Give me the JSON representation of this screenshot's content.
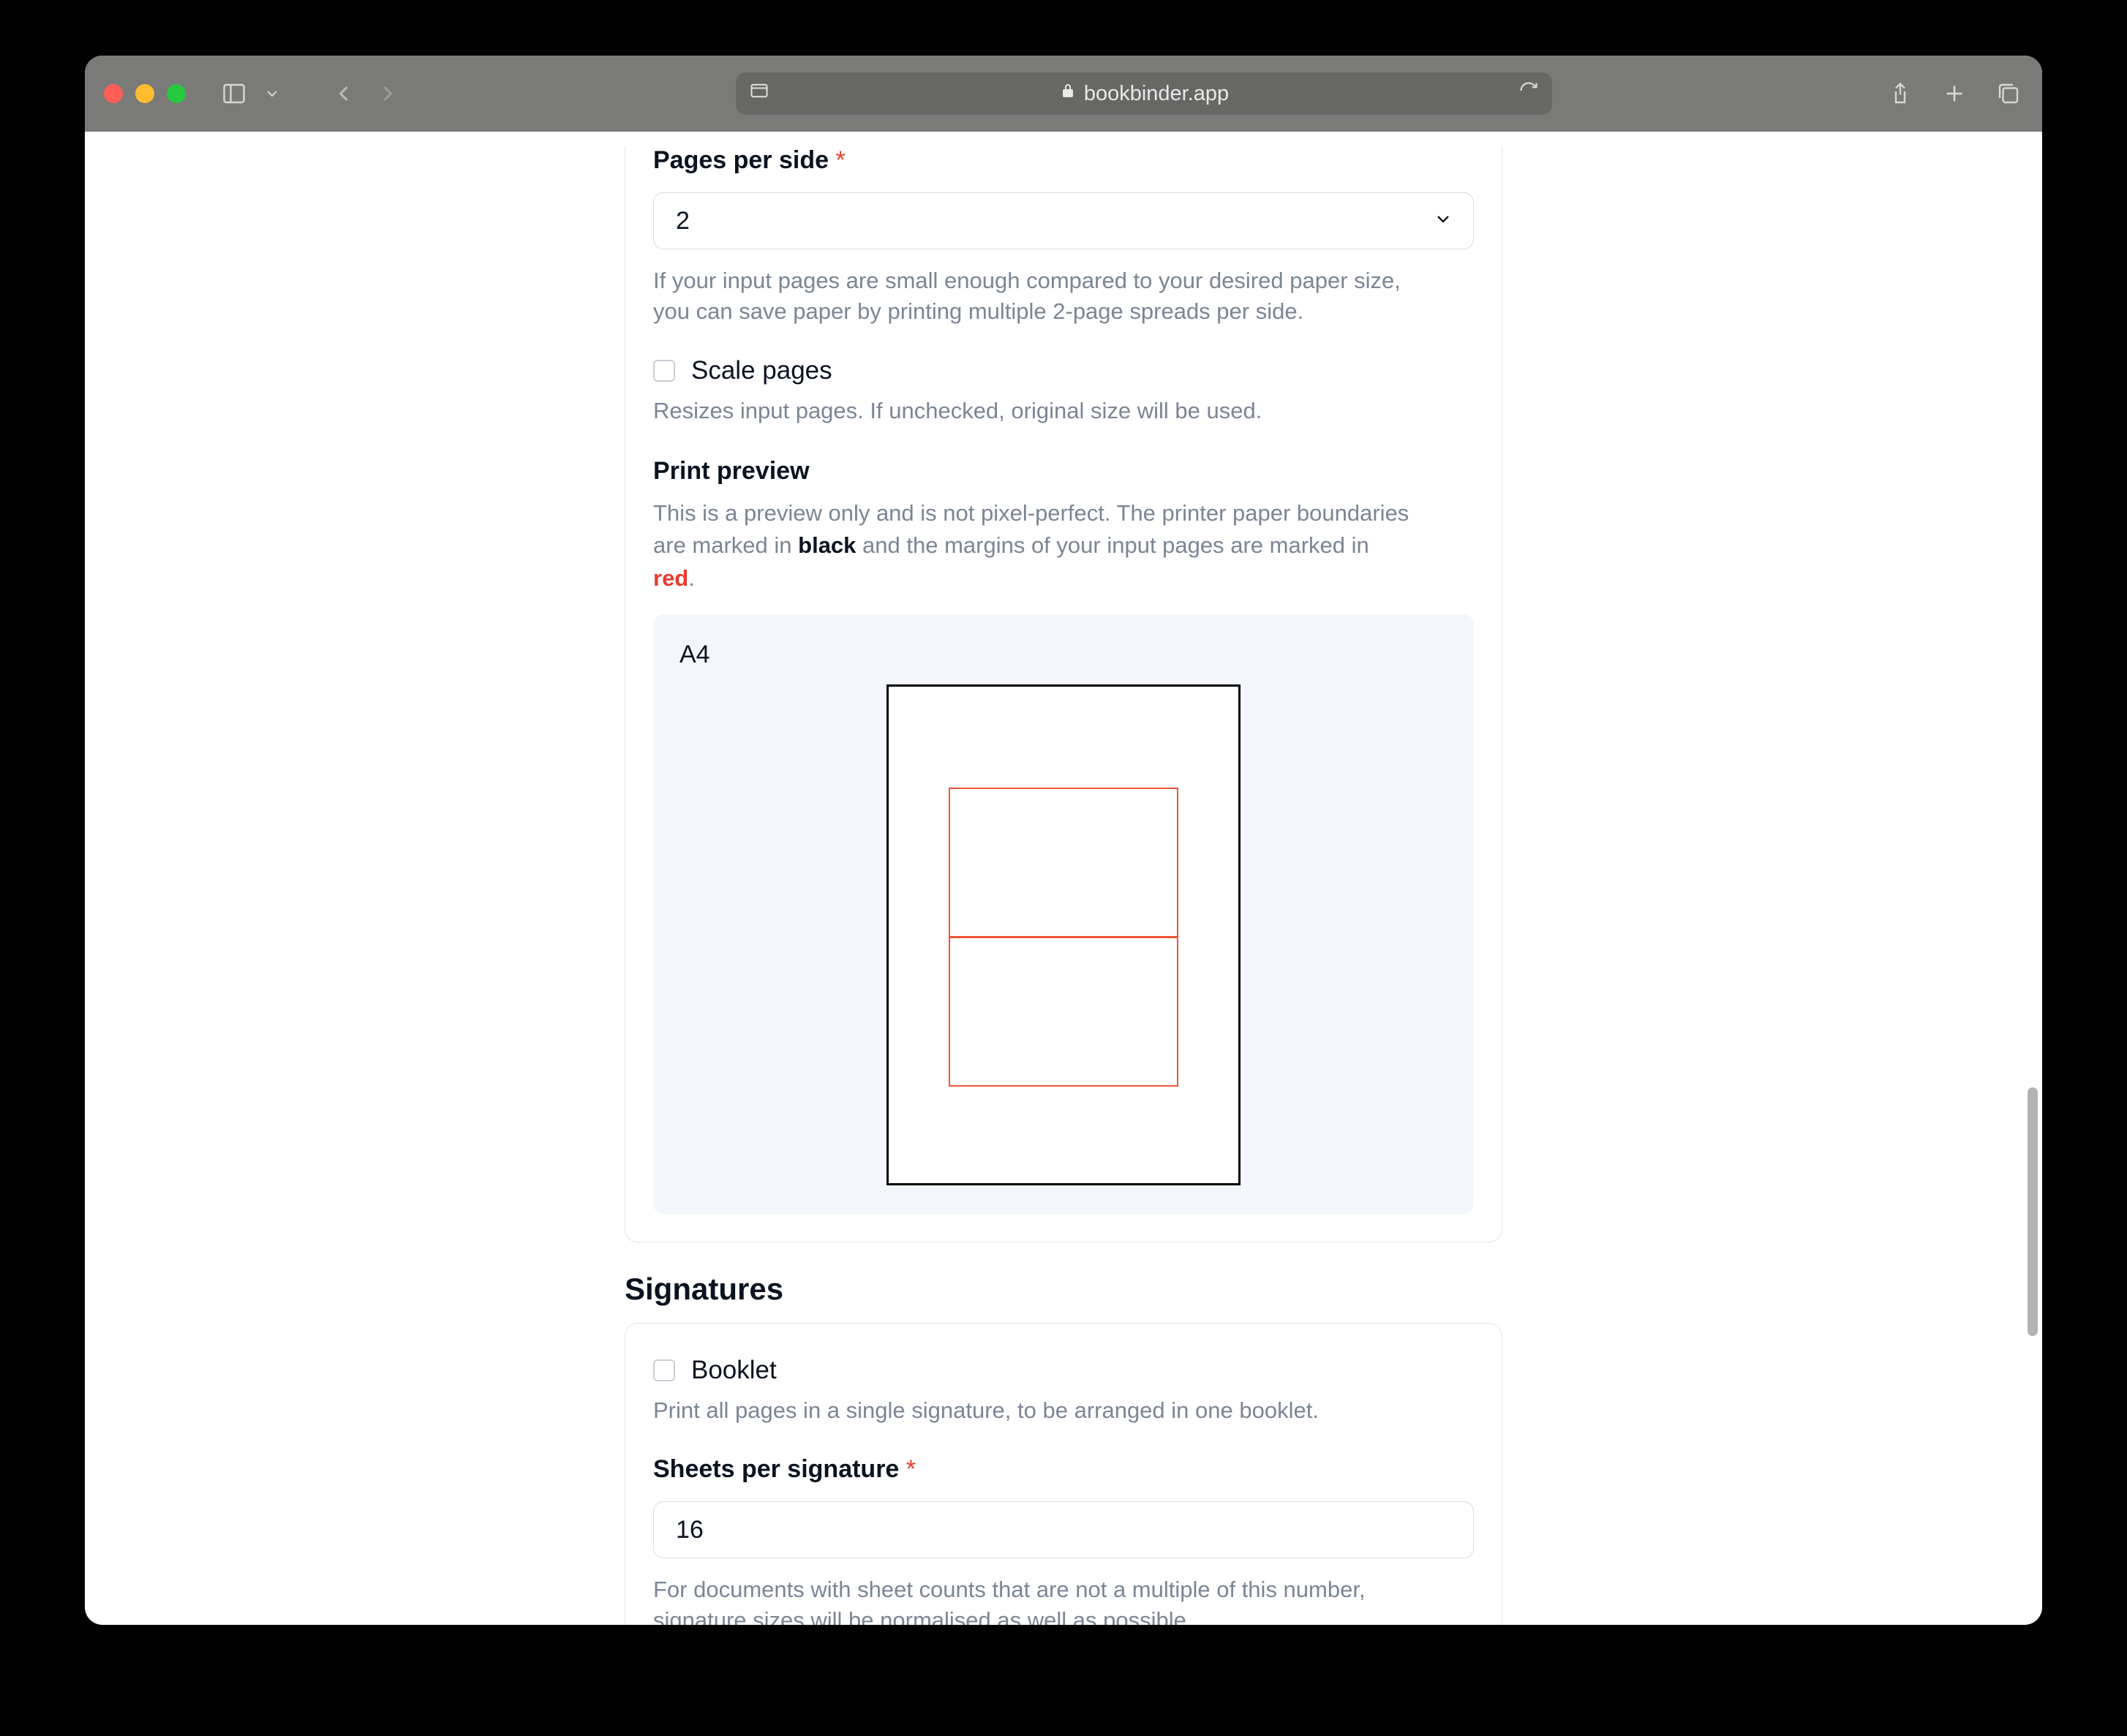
{
  "browser": {
    "url_display": "bookbinder.app"
  },
  "pagesPerSide": {
    "label": "Pages per side",
    "required": "*",
    "value": "2",
    "help": "If your input pages are small enough compared to your desired paper size, you can save paper by printing multiple 2-page spreads per side."
  },
  "scalePages": {
    "label": "Scale pages",
    "help": "Resizes input pages. If unchecked, original size will be used."
  },
  "printPreview": {
    "heading": "Print preview",
    "desc_prefix": "This is a preview only and is not pixel-perfect. The printer paper boundaries are marked in ",
    "desc_bold1": "black",
    "desc_mid": " and the margins of your input pages are marked in ",
    "desc_bold2": "red",
    "desc_suffix": ".",
    "paper_label": "A4"
  },
  "signatures": {
    "heading": "Signatures",
    "booklet": {
      "label": "Booklet",
      "help": "Print all pages in a single signature, to be arranged in one booklet."
    },
    "sheetsPerSignature": {
      "label": "Sheets per signature",
      "required": "*",
      "value": "16",
      "help": "For documents with sheet counts that are not a multiple of this number, signature sizes will be normalised as well as possible."
    }
  }
}
